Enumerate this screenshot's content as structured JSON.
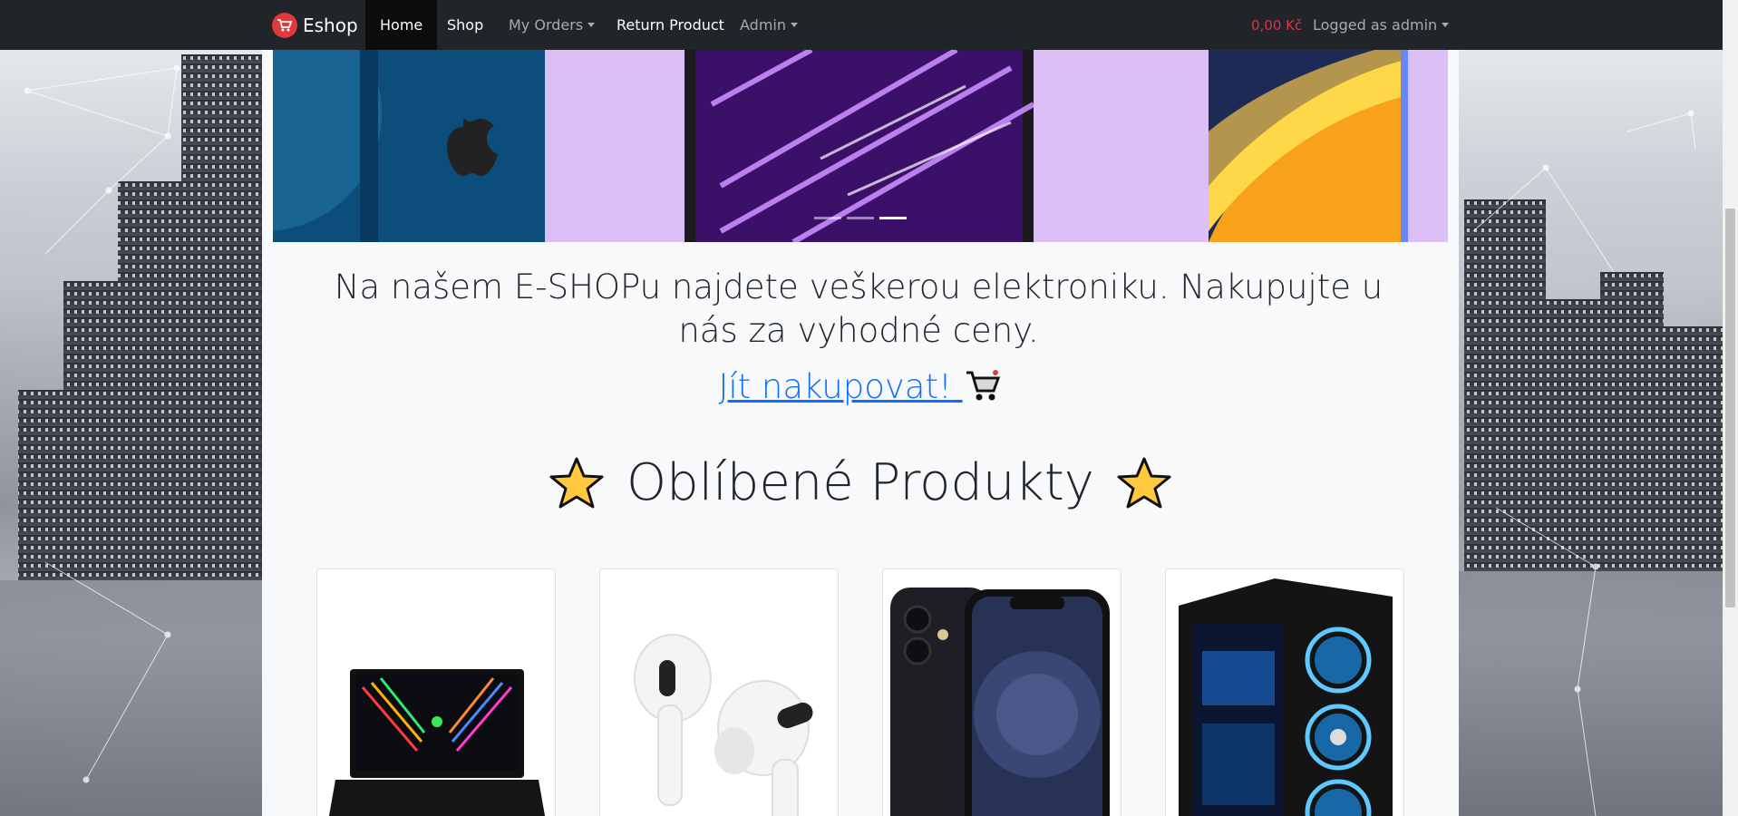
{
  "navbar": {
    "brand": "Eshop",
    "items": [
      {
        "label": "Home",
        "active": true
      },
      {
        "label": "Shop"
      },
      {
        "label": "My Orders"
      },
      {
        "label": "Return Product"
      },
      {
        "label": "Admin"
      }
    ],
    "cart_total": "0,00 Kč",
    "user_menu": "Logged as admin"
  },
  "hero": {
    "slides": 3,
    "active_slide": 3
  },
  "content": {
    "lead_text": "Na našem E-SHOPu najdete veškerou elektroniku. Nakupujte u nás za vyhodné ceny.",
    "shop_link": "Jít nakupovat!",
    "favorites_heading": "Oblíbené Produkty"
  },
  "products": [
    {
      "name": "laptop"
    },
    {
      "name": "earbuds"
    },
    {
      "name": "phone"
    },
    {
      "name": "pc-case"
    }
  ],
  "colors": {
    "navbar": "#212529",
    "link": "#0d6efd",
    "cart_total": "#dc3545",
    "carousel_bg": "#dcbff6"
  }
}
